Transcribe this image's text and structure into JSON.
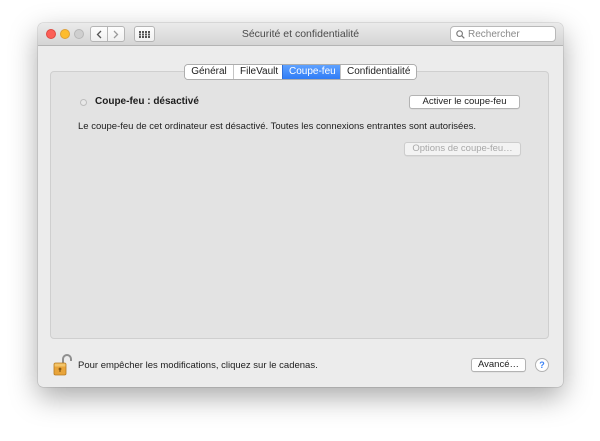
{
  "window": {
    "title": "Sécurité et confidentialité",
    "search_placeholder": "Rechercher"
  },
  "tabs": [
    {
      "label": "Général",
      "active": false
    },
    {
      "label": "FileVault",
      "active": false
    },
    {
      "label": "Coupe-feu",
      "active": true
    },
    {
      "label": "Confidentialité",
      "active": false
    }
  ],
  "firewall": {
    "status_label": "Coupe-feu : désactivé",
    "enable_button": "Activer le coupe-feu",
    "description": "Le coupe-feu de cet ordinateur est désactivé. Toutes les connexions entrantes sont autorisées.",
    "options_button": "Options de coupe-feu…",
    "options_enabled": false
  },
  "footer": {
    "lock_text": "Pour empêcher les modifications, cliquez sur le cadenas.",
    "advanced_button": "Avancé…",
    "help_glyph": "?"
  },
  "icons": {
    "close": "close-light",
    "minimize": "minimize-light",
    "zoom": "zoom-light",
    "back": "chevron-left-icon",
    "forward": "chevron-right-icon",
    "grid": "grid-icon",
    "search": "search-icon",
    "lock": "padlock-open-icon",
    "help": "help-icon"
  },
  "colors": {
    "close": "#fc5f57",
    "minimize": "#fdbc2e",
    "zoom": "#cfcfcf",
    "tab_active": "#3d8aff",
    "lock": "#e8a43a"
  }
}
